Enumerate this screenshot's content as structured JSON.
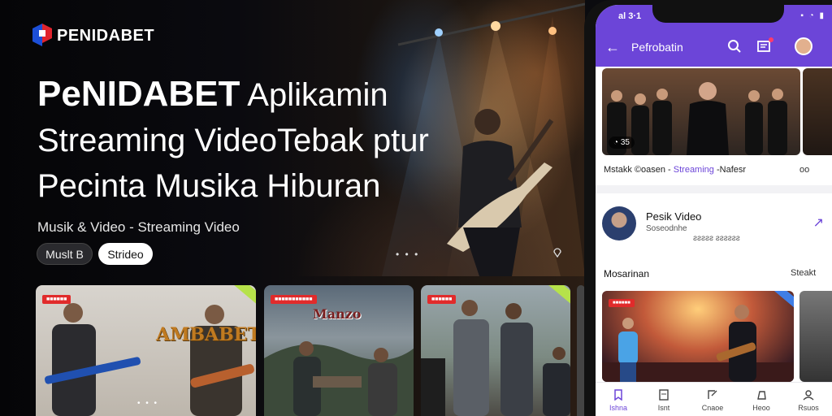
{
  "brand": {
    "logo_text": "PENIDABET"
  },
  "hero": {
    "headline_brand": "PeNIDABET",
    "headline_rest_1": " Aplikamin",
    "headline_line_2": "Streaming VideoTebak ptur",
    "headline_line_3": "Pecinta Musika Hiburan",
    "subtitle": "Musik & Video - Streaming Video",
    "pill_dark": "Muslt B",
    "pill_light": "Strideo",
    "pager_dots": "• • •"
  },
  "thumbnails": [
    {
      "tag": "■■■■■■",
      "title": "AMBABET",
      "dots": "• • •"
    },
    {
      "tag": "■■■■■■■■■■■",
      "title": "Manzo"
    },
    {
      "tag": "■■■■■■"
    }
  ],
  "phone": {
    "status_time": "al 3·1",
    "status_icons": "▪ ◔ ▮",
    "app_title": "Pefrobatin",
    "back_icon": "←",
    "feature": {
      "badge": "◔ 35",
      "caption_prefix": "Mstakk ©oasen -",
      "caption_link": "Streaming",
      "caption_suffix": "-Nafesr",
      "caption_more": "oo"
    },
    "list_item": {
      "title": "Pesik Video",
      "sub": "Soseodnhe",
      "sub2": "ƨƨƨƨƨ ƨƨƨƨƨƨ",
      "arrow": "↗"
    },
    "section": {
      "title": "Mosarinan",
      "more": "Steakt"
    },
    "concert_tag": "■■■■■■",
    "nav": [
      {
        "label": "Ishna"
      },
      {
        "label": "Isnt"
      },
      {
        "label": "Cnaoe"
      },
      {
        "label": "Heoo"
      },
      {
        "label": "Rsuos"
      }
    ]
  },
  "colors": {
    "accent": "#6c45d8",
    "tag_red": "#e12b2b"
  }
}
